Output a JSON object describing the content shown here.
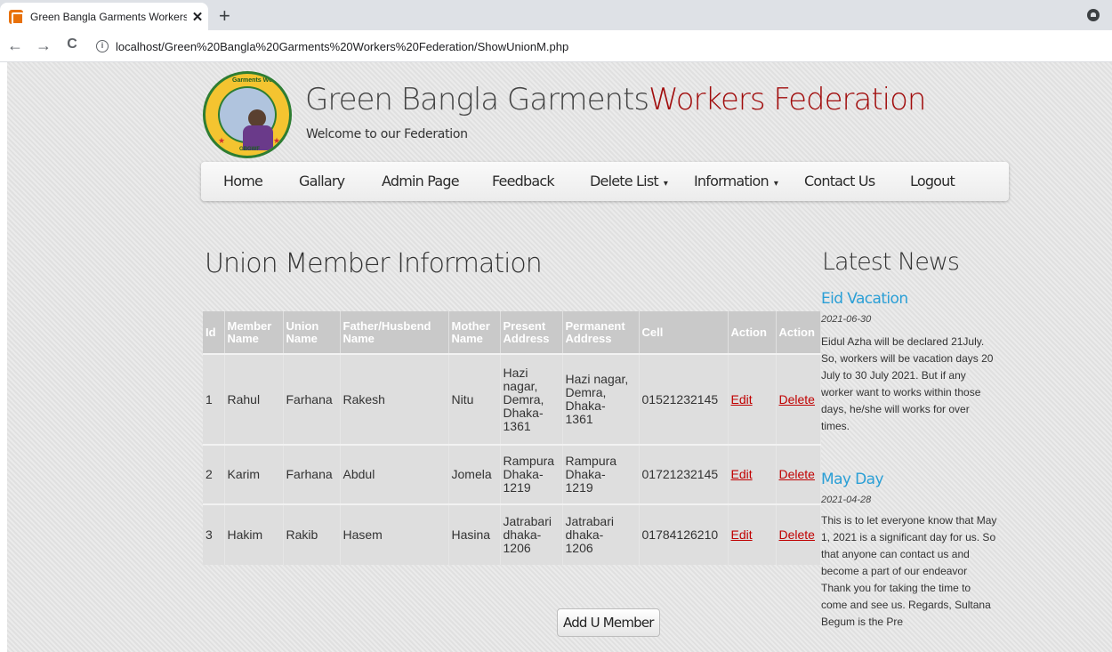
{
  "browser": {
    "tab_title": "Green Bangla Garments Workers",
    "tab_close": "✕",
    "new_tab": "+",
    "url": "localhost/Green%20Bangla%20Garments%20Workers%20Federation/ShowUnionM.php",
    "back": "←",
    "forward": "→",
    "reload": "C",
    "info": "i"
  },
  "header": {
    "title_main": "Green Bangla Garments",
    "title_accent": "Workers Federation",
    "subtitle": "Welcome to our Federation",
    "logo_text_top": "Garments Workers",
    "logo_text_bottom": "GBGWF"
  },
  "nav": {
    "items": [
      "Home",
      "Gallary",
      "Admin Page",
      "Feedback",
      "Delete List",
      "Information",
      "Contact Us",
      "Logout"
    ],
    "caret": "▾"
  },
  "main": {
    "heading": "Union Member Information",
    "columns": [
      [
        "Id"
      ],
      [
        "Member",
        "Name"
      ],
      [
        "Union",
        "Name"
      ],
      [
        "Father/Husbend",
        "Name"
      ],
      [
        "Mother",
        "Name"
      ],
      [
        "Present",
        "Address"
      ],
      [
        "Permanent",
        "Address"
      ],
      [
        "Cell"
      ],
      [
        "Action"
      ],
      [
        "Action"
      ]
    ],
    "rows": [
      {
        "id": "1",
        "member": "Rahul",
        "union": "Farhana",
        "father": "Rakesh",
        "mother": "Nitu",
        "present": [
          "Hazi",
          "nagar,",
          "Demra,",
          "Dhaka-",
          "1361"
        ],
        "permanent": [
          "Hazi nagar,",
          "Demra,",
          "Dhaka-",
          "1361"
        ],
        "cell": "01521232145",
        "edit": "Edit",
        "delete": "Delete"
      },
      {
        "id": "2",
        "member": "Karim",
        "union": "Farhana",
        "father": "Abdul",
        "mother": "Jomela",
        "present": [
          "Rampura",
          "Dhaka-",
          "1219"
        ],
        "permanent": [
          "Rampura",
          "Dhaka-",
          "1219"
        ],
        "cell": "01721232145",
        "edit": "Edit",
        "delete": "Delete"
      },
      {
        "id": "3",
        "member": "Hakim",
        "union": "Rakib",
        "father": "Hasem",
        "mother": "Hasina",
        "present": [
          "Jatrabari",
          "dhaka-",
          "1206"
        ],
        "permanent": [
          "Jatrabari",
          "dhaka-",
          "1206"
        ],
        "cell": "01784126210",
        "edit": "Edit",
        "delete": "Delete"
      }
    ],
    "add_button": "Add U Member"
  },
  "sidebar": {
    "heading": "Latest News",
    "news": [
      {
        "title": "Eid Vacation",
        "date": "2021-06-30",
        "body": "Eidul Azha will be declared 21July. So, workers will be vacation days 20 July to 30 July 2021. But if any worker want to works within those days, he/she will works for over times."
      },
      {
        "title": "May Day",
        "date": "2021-04-28",
        "body": "This is to let everyone know that May 1, 2021 is a significant day for us. So that anyone can contact us and become a part of our endeavor Thank you for taking the time to come and see us. Regards, Sultana Begum is the Pre"
      }
    ]
  }
}
